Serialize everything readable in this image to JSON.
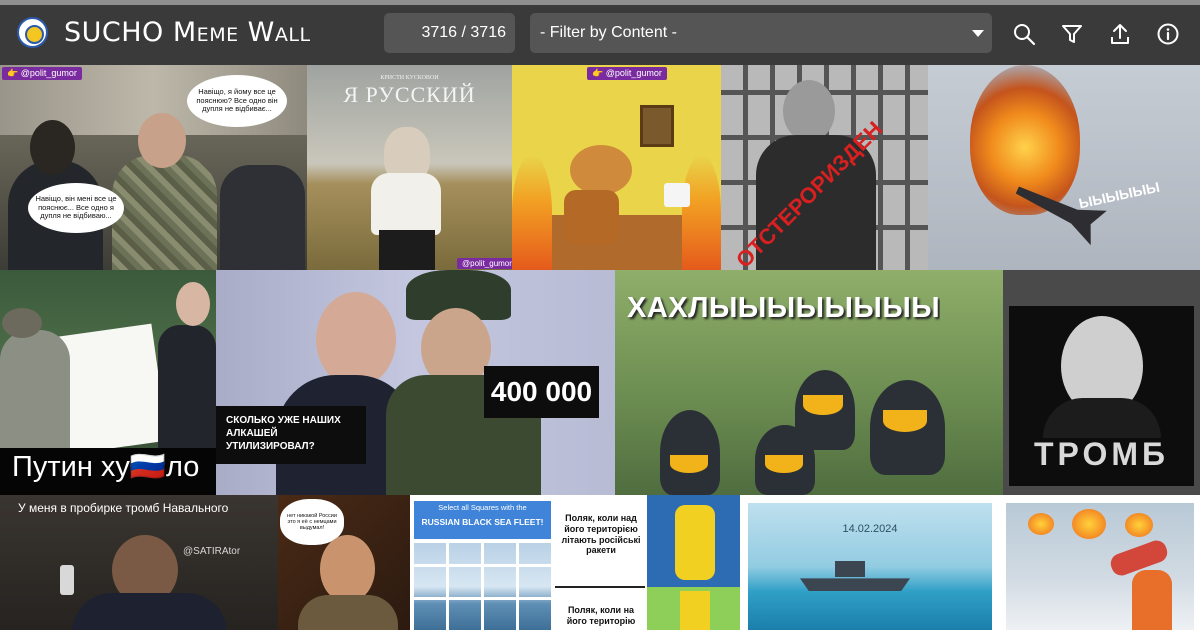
{
  "header": {
    "title": "SUCHO Meme Wall",
    "counter": "3716 / 3716",
    "filter_placeholder": "- Filter by Content -",
    "icons": [
      "search-icon",
      "filter-icon",
      "upload-icon",
      "info-icon"
    ]
  },
  "colors": {
    "topbar": "#3a3a3a",
    "control_bg": "#555555",
    "text": "#ffffff"
  },
  "memes": {
    "m1": {
      "handle": "👉 @polit_gumor",
      "bubble_top": "Навіщо, я йому все це пояснюю? Все одно він дупля не відбиває...",
      "bubble_bottom": "Навіщо, він мені все це пояснює... Все одно я дупля не відбиваю..."
    },
    "m2": {
      "small": "КРИСТИ КУСКОВОЙ",
      "title": "Я РУССКИЙ",
      "handle": "@polit_gumor"
    },
    "m3": {
      "handle": "👉 @polit_gumor"
    },
    "m4": {
      "text": "ОТСТЕРОРИЗДЕН"
    },
    "m5": {
      "text": "ЫЫЫЫЫЫ"
    },
    "m6": {
      "text": "Путин ху🇷🇺ло"
    },
    "m7": {
      "left": "СКОЛЬКО УЖЕ НАШИХ АЛКАШЕЙ УТИЛИЗИРОВАЛ?",
      "right": "400 000"
    },
    "m8": {
      "text": "ХАХЛЫЫЫЫЫЫЫЫ"
    },
    "m9": {
      "text": "ТРОМБ"
    },
    "m10": {
      "text": "У меня в пробирке тромб Навального",
      "handle": "@SATIRAtor"
    },
    "m11": {
      "bubble": "нет никакой России это я её с немцами выдумал!"
    },
    "m12": {
      "line1": "Select all Squares with the",
      "line2": "RUSSIAN BLACK SEA FLEET!"
    },
    "m13": {
      "top": "Поляк, коли над його територією літають російські ракети",
      "bottom": "Поляк, коли на його територію"
    },
    "m14": {
      "date": "14.02.2024"
    }
  }
}
